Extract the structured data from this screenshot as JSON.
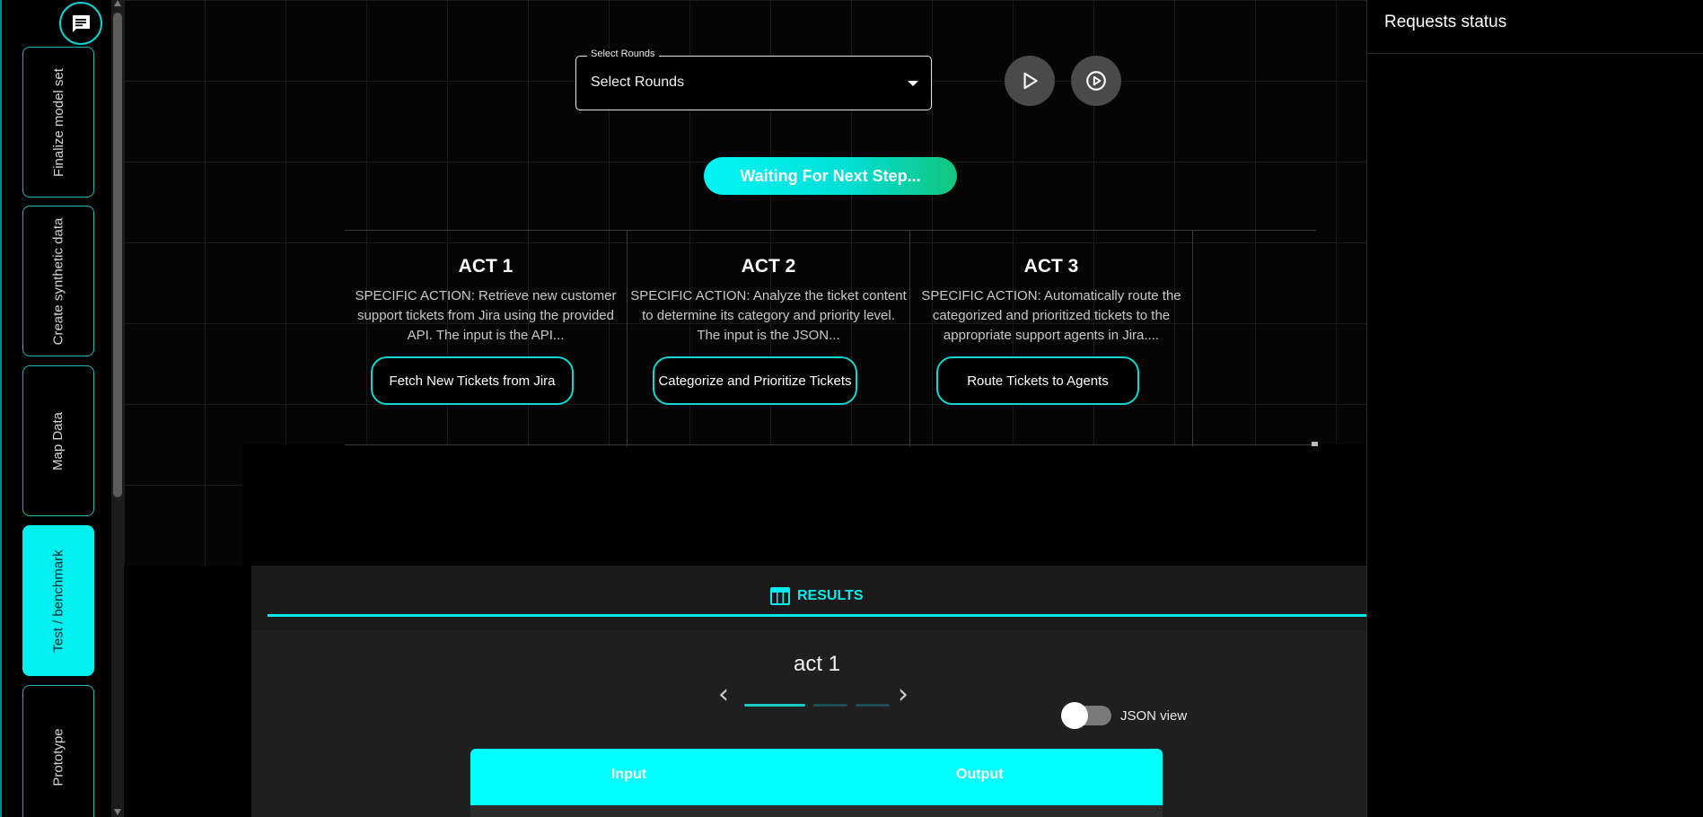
{
  "sidebar": {
    "items": [
      {
        "label": "Finalize model set",
        "active": false
      },
      {
        "label": "Create synthetic data",
        "active": false
      },
      {
        "label": "Map Data",
        "active": false
      },
      {
        "label": "Test / benchmark",
        "active": true
      },
      {
        "label": "Prototype",
        "active": false
      }
    ]
  },
  "controls": {
    "select_legend": "Select Rounds",
    "select_value": "Select Rounds",
    "status": "Waiting For Next Step..."
  },
  "acts": [
    {
      "title": "ACT 1",
      "description": "SPECIFIC ACTION: Retrieve new customer support tickets from Jira using the provided API. The input is the API...",
      "button": "Fetch New Tickets from Jira"
    },
    {
      "title": "ACT 2",
      "description": "SPECIFIC ACTION: Analyze the ticket content to determine its category and priority level. The input is the JSON...",
      "button": "Categorize and Prioritize Tickets"
    },
    {
      "title": "ACT 3",
      "description": "SPECIFIC ACTION: Automatically route the categorized and prioritized tickets to the appropriate support agents in Jira....",
      "button": "Route Tickets to Agents"
    }
  ],
  "right_panel": {
    "title": "Requests status"
  },
  "results": {
    "tab_label": "RESULTS",
    "current_act": "act 1",
    "page": 1,
    "page_count": 3,
    "json_view_label": "JSON view",
    "json_view_on": false,
    "table_headers": [
      "Input",
      "Output"
    ]
  },
  "colors": {
    "accent": "#00f0f0",
    "pill_gradient_end": "#14c47e"
  },
  "icons": [
    "chat-icon",
    "play-icon",
    "play-circle-icon",
    "table-icon",
    "chevron-left-icon",
    "chevron-right-icon",
    "dropdown-caret-icon"
  ]
}
